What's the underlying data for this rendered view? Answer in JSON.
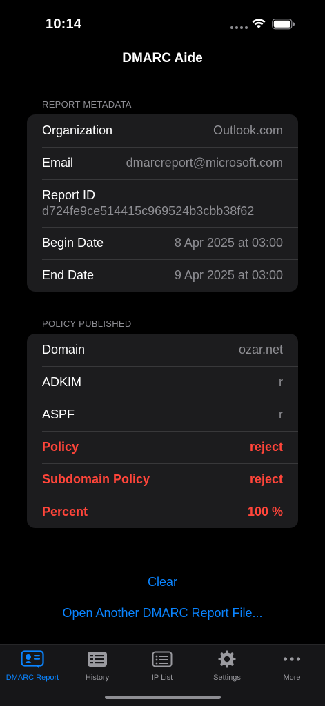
{
  "status_bar": {
    "time": "10:14"
  },
  "nav": {
    "title": "DMARC Aide"
  },
  "metadata_section": {
    "header": "REPORT METADATA",
    "rows": {
      "organization": {
        "label": "Organization",
        "value": "Outlook.com"
      },
      "email": {
        "label": "Email",
        "value": "dmarcreport@microsoft.com"
      },
      "report_id": {
        "label": "Report ID",
        "value": "d724fe9ce514415c969524b3cbb38f62"
      },
      "begin_date": {
        "label": "Begin Date",
        "value": "8 Apr 2025 at 03:00"
      },
      "end_date": {
        "label": "End Date",
        "value": "9 Apr 2025 at 03:00"
      }
    }
  },
  "policy_section": {
    "header": "POLICY PUBLISHED",
    "rows": {
      "domain": {
        "label": "Domain",
        "value": "ozar.net"
      },
      "adkim": {
        "label": "ADKIM",
        "value": "r"
      },
      "aspf": {
        "label": "ASPF",
        "value": "r"
      },
      "policy": {
        "label": "Policy",
        "value": "reject"
      },
      "subdomain_policy": {
        "label": "Subdomain Policy",
        "value": "reject"
      },
      "percent": {
        "label": "Percent",
        "value": "100 %"
      }
    }
  },
  "actions": {
    "clear": "Clear",
    "open_another": "Open Another DMARC Report File..."
  },
  "tab_bar": {
    "tabs": [
      {
        "label": "DMARC Report",
        "icon": "dmarc-report-icon",
        "active": true
      },
      {
        "label": "History",
        "icon": "history-icon",
        "active": false
      },
      {
        "label": "IP List",
        "icon": "ip-list-icon",
        "active": false
      },
      {
        "label": "Settings",
        "icon": "gear-icon",
        "active": false
      },
      {
        "label": "More",
        "icon": "ellipsis-icon",
        "active": false
      }
    ]
  },
  "colors": {
    "accent": "#0a84ff",
    "danger": "#ff453a",
    "group_background": "#1c1c1e",
    "secondary_text": "#8e8e93"
  }
}
